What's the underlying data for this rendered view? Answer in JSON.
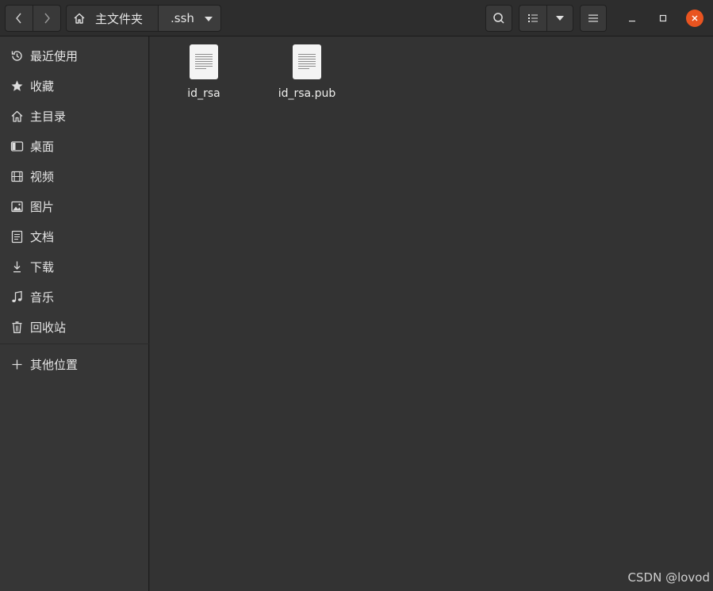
{
  "headerbar": {
    "path": [
      {
        "label": "主文件夹",
        "icon": "home-icon"
      },
      {
        "label": ".ssh"
      }
    ]
  },
  "sidebar": {
    "items": [
      {
        "label": "最近使用",
        "icon": "recent-icon"
      },
      {
        "label": "收藏",
        "icon": "star-icon"
      },
      {
        "label": "主目录",
        "icon": "home-icon"
      },
      {
        "label": "桌面",
        "icon": "desktop-icon"
      },
      {
        "label": "视频",
        "icon": "video-icon"
      },
      {
        "label": "图片",
        "icon": "picture-icon"
      },
      {
        "label": "文档",
        "icon": "document-icon"
      },
      {
        "label": "下载",
        "icon": "download-icon"
      },
      {
        "label": "音乐",
        "icon": "music-icon"
      },
      {
        "label": "回收站",
        "icon": "trash-icon"
      }
    ],
    "other": {
      "label": "其他位置",
      "icon": "plus-icon"
    }
  },
  "files": [
    {
      "name": "id_rsa",
      "icon": "text-file-icon"
    },
    {
      "name": "id_rsa.pub",
      "icon": "text-file-icon"
    }
  ],
  "watermark": "CSDN @lovod",
  "colors": {
    "close": "#e95420",
    "content_bg": "#333333",
    "sidebar_bg": "#363636"
  }
}
